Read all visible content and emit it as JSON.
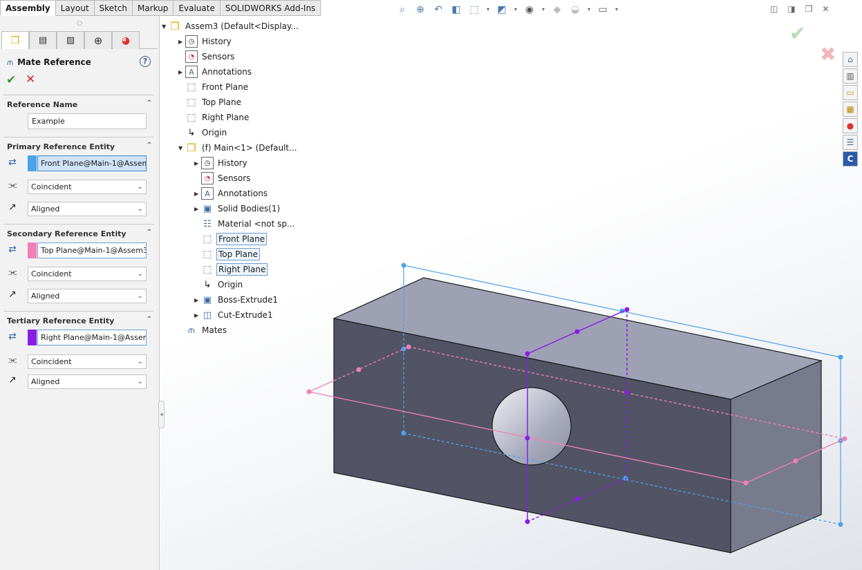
{
  "command_tabs": [
    "Assembly",
    "Layout",
    "Sketch",
    "Markup",
    "Evaluate",
    "SOLIDWORKS Add-Ins"
  ],
  "active_tab": "Assembly",
  "property_manager": {
    "title": "Mate Reference",
    "help": "?",
    "ok": "✔",
    "cancel": "✕",
    "reference_name": {
      "header": "Reference Name",
      "value": "Example"
    },
    "primary": {
      "header": "Primary Reference Entity",
      "entity": "Front Plane@Main-1@Assem",
      "mate_type": "Coincident",
      "alignment": "Aligned",
      "color": "#4aa3ea"
    },
    "secondary": {
      "header": "Secondary Reference Entity",
      "entity": "Top Plane@Main-1@Assem3",
      "mate_type": "Coincident",
      "alignment": "Aligned",
      "color": "#f27fb6"
    },
    "tertiary": {
      "header": "Tertiary Reference Entity",
      "entity": "Right Plane@Main-1@Assem",
      "mate_type": "Coincident",
      "alignment": "Aligned",
      "color": "#8a1ee6"
    }
  },
  "tree": {
    "root": "Assem3  (Default<Display...",
    "root_items": [
      "History",
      "Sensors",
      "Annotations",
      "Front Plane",
      "Top Plane",
      "Right Plane",
      "Origin"
    ],
    "component": "(f) Main<1> (Default...",
    "component_items": [
      "History",
      "Sensors",
      "Annotations",
      "Solid Bodies(1)",
      "Material <not sp...",
      "Front Plane",
      "Top Plane",
      "Right Plane",
      "Origin",
      "Boss-Extrude1",
      "Cut-Extrude1"
    ],
    "mates": "Mates"
  },
  "colors": {
    "accent_blue": "#4aa3ea",
    "accent_pink": "#f27fb6",
    "accent_purple": "#8a1ee6",
    "part_dark": "#525466",
    "part_top": "#9ea1b4",
    "part_side": "#787b8d"
  },
  "icons": [
    "zoom-to-fit-icon",
    "zoom-area-icon",
    "previous-view-icon",
    "section-view-icon",
    "view-orientation-icon",
    "display-style-icon",
    "hide-show-icon",
    "edit-appearance-icon",
    "apply-scene-icon",
    "view-settings-icon"
  ],
  "task_pane": [
    "home-icon",
    "design-library-icon",
    "file-explorer-icon",
    "view-palette-icon",
    "appearances-icon",
    "custom-properties-icon",
    "solidworks-c-icon"
  ]
}
